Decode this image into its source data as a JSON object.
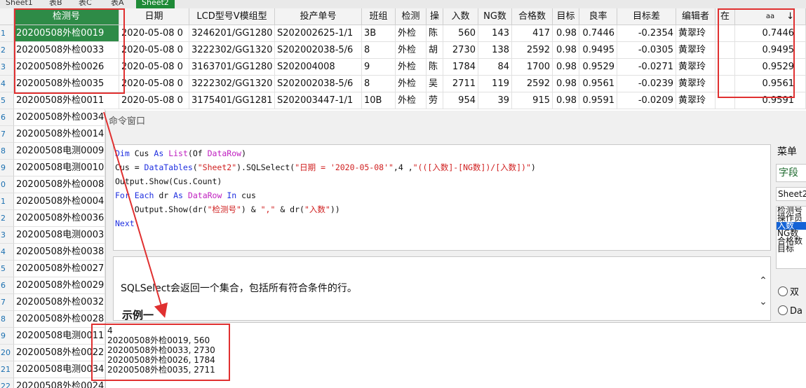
{
  "sheet_tabs": [
    {
      "label": "Sheet1",
      "active": false
    },
    {
      "label": "表B",
      "active": false
    },
    {
      "label": "表C",
      "active": false
    },
    {
      "label": "表A",
      "active": false
    },
    {
      "label": "Sheet2",
      "active": true
    }
  ],
  "grid": {
    "columns": [
      "检测号",
      "日期",
      "LCD型号V模组型",
      "投产单号",
      "班组",
      "检测",
      "操",
      "入数",
      "NG数",
      "合格数",
      "目标",
      "良率",
      "目标差",
      "编辑者",
      "在",
      "aa"
    ],
    "sort_indicator": "↓",
    "row_numbers": [
      "1",
      "2",
      "3",
      "4",
      "5",
      "6",
      "7",
      "8",
      "9",
      "0",
      "1",
      "2",
      "3",
      "4",
      "5",
      "6",
      "7",
      "8",
      "9",
      "20",
      "21",
      "22"
    ],
    "rows": [
      [
        "20200508外检0019",
        "2020-05-08 0",
        "3246201/GG1280",
        "S202002625-1/1",
        "3B",
        "外检",
        "陈",
        "560",
        "143",
        "417",
        "0.98",
        "0.7446",
        "-0.2354",
        "黄翠玲",
        "",
        "0.7446"
      ],
      [
        "20200508外检0033",
        "2020-05-08 0",
        "3222302/GG1320",
        "S202002038-5/6",
        "8",
        "外检",
        "胡",
        "2730",
        "138",
        "2592",
        "0.98",
        "0.9495",
        "-0.0305",
        "黄翠玲",
        "",
        "0.9495"
      ],
      [
        "20200508外检0026",
        "2020-05-08 0",
        "3163701/GG1280",
        "S202004008",
        "9",
        "外检",
        "陈",
        "1784",
        "84",
        "1700",
        "0.98",
        "0.9529",
        "-0.0271",
        "黄翠玲",
        "",
        "0.9529"
      ],
      [
        "20200508外检0035",
        "2020-05-08 0",
        "3222302/GG1320",
        "S202002038-5/6",
        "8",
        "外检",
        "吴",
        "2711",
        "119",
        "2592",
        "0.98",
        "0.9561",
        "-0.0239",
        "黄翠玲",
        "",
        "0.9561"
      ],
      [
        "20200508外检0011",
        "2020-05-08 0",
        "3175401/GG1281",
        "S202003447-1/1",
        "10B",
        "外检",
        "劳",
        "954",
        "39",
        "915",
        "0.98",
        "0.9591",
        "-0.0209",
        "黄翠玲",
        "",
        "0.9591"
      ]
    ],
    "more_first_col": [
      "20200508外检0034",
      "20200508外检0014",
      "20200508电测0009",
      "20200508电测0010",
      "20200508外检0008",
      "20200508外检0004",
      "20200508外检0036",
      "20200508电测0003",
      "20200508外检0038",
      "20200508外检0027",
      "20200508外检0029",
      "20200508外检0032",
      "20200508外检0028",
      "20200508电测0011",
      "20200508外检0022",
      "20200508电测0034",
      "20200508外检0024"
    ]
  },
  "command_window": {
    "title": "命令窗口",
    "code_lines": [
      [
        [
          "kw",
          "Dim"
        ],
        [
          "pl",
          " Cus "
        ],
        [
          "kw",
          "As"
        ],
        [
          "pl",
          " "
        ],
        [
          "tp",
          "List"
        ],
        [
          "pl",
          "(Of "
        ],
        [
          "tp",
          "DataRow"
        ],
        [
          "pl",
          ")"
        ]
      ],
      [
        [
          "pl",
          "Cus = "
        ],
        [
          "kw",
          "DataTables"
        ],
        [
          "pl",
          "("
        ],
        [
          "st",
          "\"Sheet2\""
        ],
        [
          "pl",
          ").SQLSelect("
        ],
        [
          "st",
          "\"日期 = '2020-05-08'\""
        ],
        [
          "pl",
          ",4 ,"
        ],
        [
          "st",
          "\"(([入数]-[NG数])/[入数])\""
        ],
        [
          "pl",
          ")"
        ]
      ],
      [
        [
          "pl",
          "Output.Show(Cus.Count)"
        ]
      ],
      [
        [
          "kw",
          "For"
        ],
        [
          "pl",
          " "
        ],
        [
          "kw",
          "Each"
        ],
        [
          "pl",
          " dr "
        ],
        [
          "kw",
          "As"
        ],
        [
          "pl",
          " "
        ],
        [
          "tp",
          "DataRow"
        ],
        [
          "pl",
          " "
        ],
        [
          "kw",
          "In"
        ],
        [
          "pl",
          " cus"
        ]
      ],
      [
        [
          "pl",
          "    Output.Show(dr("
        ],
        [
          "st",
          "\"检测号\""
        ],
        [
          "pl",
          ") & "
        ],
        [
          "st",
          "\",\""
        ],
        [
          "pl",
          " & dr("
        ],
        [
          "st",
          "\"入数\""
        ],
        [
          "pl",
          "))"
        ]
      ],
      [
        [
          "kw",
          "Next"
        ]
      ]
    ],
    "help_text": "SQLSelect会返回一个集合，包括所有符合条件的行。",
    "help_example": "示例一",
    "output_lines": [
      "4",
      "20200508外检0019, 560",
      "20200508外检0033, 2730",
      "20200508外检0026, 1784",
      "20200508外检0035, 2711"
    ]
  },
  "right_panel": {
    "menu_label": "菜单",
    "field_input": "字段",
    "table_combo": "Sheet2",
    "field_list": [
      "检测号",
      "操作员",
      "入数",
      "NG数",
      "合格数",
      "目标"
    ],
    "field_list_selected": "入数",
    "radio1": "双",
    "radio2": "Da"
  },
  "colors": {
    "selected_green": "#2e8b47",
    "annotation_red": "#e03030",
    "keyword_blue": "#1f2fe0",
    "type_magenta": "#c020c0",
    "string_red": "#d02020",
    "list_highlight": "#1463d6"
  }
}
